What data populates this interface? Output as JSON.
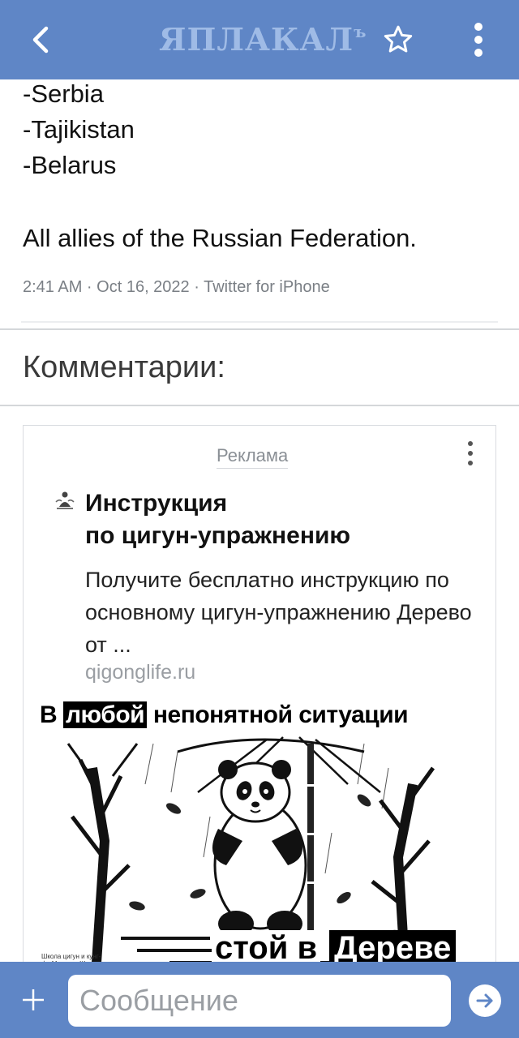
{
  "header": {
    "logo_text": "ЯПЛАКАЛ",
    "logo_suffix": "ъ",
    "colors": {
      "bar": "#5f86c6",
      "logo": "#9fbbe6"
    }
  },
  "tweet": {
    "lines": [
      "-Serbia",
      "-Tajikistan",
      "-Belarus"
    ],
    "summary": "All allies of the Russian Federation.",
    "meta": "2:41 AM · Oct 16, 2022 · Twitter for iPhone"
  },
  "comments": {
    "title": "Комментарии:"
  },
  "ad": {
    "label": "Реклама",
    "title_line1": "Инструкция",
    "title_line2": "по цигун-упражнению",
    "description": "Получите бесплатно инструкцию по основному цигун-упражнению Дерево от ...",
    "domain": "qigonglife.ru",
    "creative": {
      "top_before": "В ",
      "top_highlight": "любой",
      "top_after": " непонятной ситуации",
      "bottom_white": "стой в",
      "bottom_black": "Дереве",
      "school": "Школа цигун и кунг-фу Мастера Ши Яньмина"
    }
  },
  "composer": {
    "placeholder": "Сообщение"
  }
}
